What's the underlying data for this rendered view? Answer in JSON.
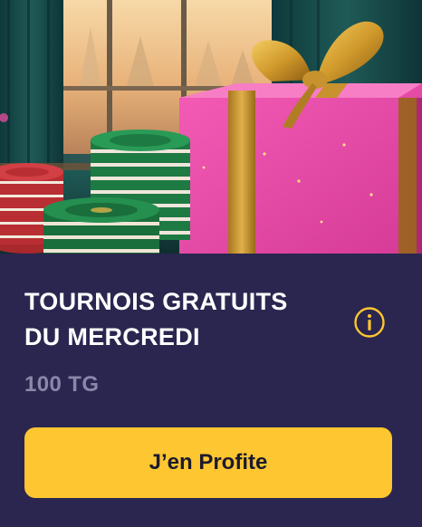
{
  "promo": {
    "title_line1": "TOURNOIS GRATUITS",
    "title_line2": "DU MERCREDI",
    "amount": "100 TG",
    "cta_label": "J’en Profite",
    "info_icon": "info-circle-icon",
    "hero_image": "gift-box-and-poker-chips-illustration"
  },
  "colors": {
    "card_background": "#2a2650",
    "title": "#ffffff",
    "amount": "#8b87a9",
    "cta_background": "#fec630",
    "cta_text": "#1c1a2e",
    "info_icon": "#fec630"
  }
}
